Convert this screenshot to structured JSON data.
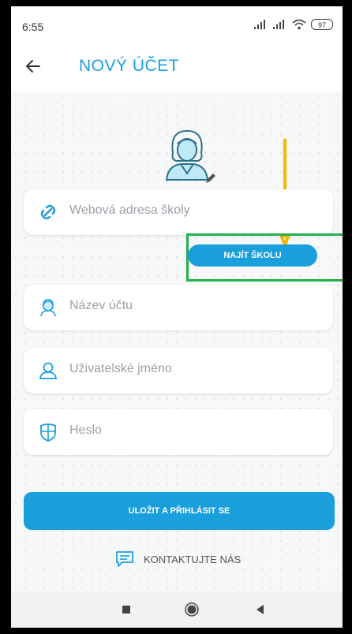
{
  "status_bar": {
    "time": "6:55",
    "battery": "97"
  },
  "app_bar": {
    "title": "NOVÝ ÚČET",
    "back_icon": "arrow-left-icon"
  },
  "form": {
    "school_url_placeholder": "Webová adresa školy",
    "find_school_label": "NAJÍT ŠKOLU",
    "account_name_placeholder": "Název účtu",
    "username_placeholder": "Uživatelské jméno",
    "password_placeholder": "Heslo",
    "save_label": "ULOŽIT A PŘIHLÁSIT SE",
    "contact_label": "KONTAKTUJTE NÁS"
  },
  "colors": {
    "accent": "#1a9fdc",
    "annotation_arrow": "#f5b800",
    "annotation_box": "#22b14c"
  },
  "nav_bar": {
    "icons": [
      "recent-apps-icon",
      "home-icon",
      "back-icon"
    ]
  }
}
